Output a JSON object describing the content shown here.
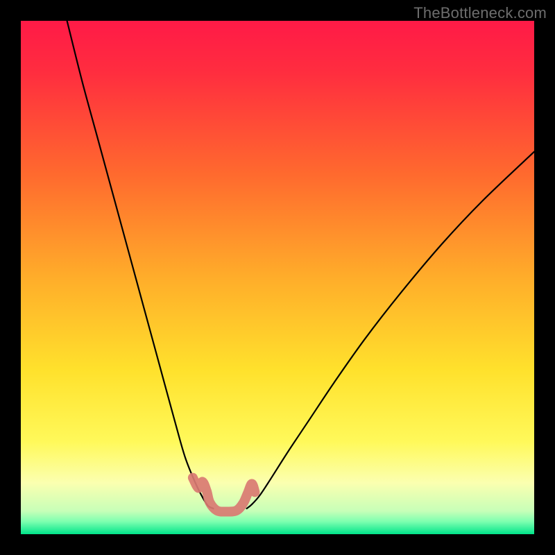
{
  "watermark": "TheBottleneck.com",
  "chart_data": {
    "type": "line",
    "title": "",
    "xlabel": "",
    "ylabel": "",
    "xlim": [
      0,
      100
    ],
    "ylim": [
      0,
      100
    ],
    "grid": false,
    "background": {
      "description": "vertical gradient: red (top) -> orange -> yellow -> pale green (bottom), with thin green band at very bottom",
      "stops": [
        {
          "pos": 0.0,
          "color": "#ff1a47"
        },
        {
          "pos": 0.1,
          "color": "#ff2d3f"
        },
        {
          "pos": 0.3,
          "color": "#ff6a2e"
        },
        {
          "pos": 0.5,
          "color": "#ffad2a"
        },
        {
          "pos": 0.68,
          "color": "#ffe12c"
        },
        {
          "pos": 0.82,
          "color": "#fff95a"
        },
        {
          "pos": 0.9,
          "color": "#fbffb0"
        },
        {
          "pos": 0.955,
          "color": "#c7ffb8"
        },
        {
          "pos": 0.975,
          "color": "#7fffb0"
        },
        {
          "pos": 1.0,
          "color": "#00e58a"
        }
      ]
    },
    "series": [
      {
        "name": "left-curve",
        "stroke": "#000000",
        "x": [
          9.0,
          12.0,
          15.0,
          18.0,
          21.0,
          24.0,
          27.0,
          30.0,
          32.0,
          34.0,
          35.5,
          36.5,
          37.5
        ],
        "values": [
          100.0,
          88.0,
          77.0,
          66.0,
          55.0,
          44.0,
          33.0,
          22.0,
          15.0,
          10.0,
          7.0,
          5.5,
          5.0
        ]
      },
      {
        "name": "right-curve",
        "stroke": "#000000",
        "x": [
          44.0,
          45.0,
          46.5,
          48.5,
          52.0,
          56.0,
          61.0,
          67.0,
          74.0,
          82.0,
          90.0,
          100.0
        ],
        "values": [
          5.0,
          5.8,
          7.5,
          10.5,
          16.0,
          22.0,
          29.5,
          38.0,
          47.0,
          56.5,
          65.0,
          74.5
        ]
      },
      {
        "name": "bottom-squiggle",
        "stroke": "#d97a72",
        "x": [
          33.5,
          34.6,
          35.4,
          36.2,
          36.8,
          38.2,
          40.0,
          42.0,
          43.3,
          44.2,
          45.0,
          45.6
        ],
        "values": [
          11.0,
          9.0,
          10.2,
          8.4,
          6.2,
          4.6,
          4.4,
          4.6,
          6.0,
          8.0,
          9.8,
          8.2
        ]
      }
    ]
  }
}
